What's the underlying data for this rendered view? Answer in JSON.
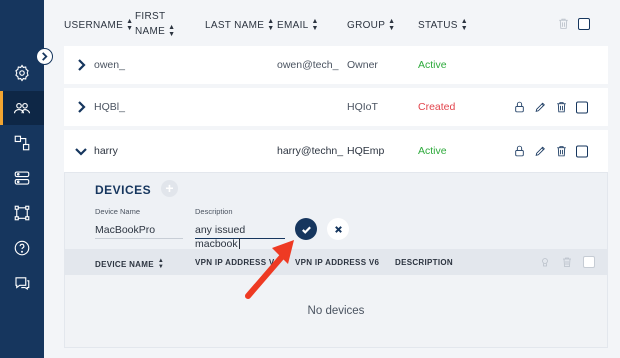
{
  "table": {
    "headers": {
      "username": "USERNAME",
      "first_name_line1": "FIRST",
      "first_name_line2": "NAME",
      "last_name": "LAST NAME",
      "email": "EMAIL",
      "group": "GROUP",
      "status": "STATUS"
    },
    "rows": [
      {
        "username": "owen_",
        "email": "owen@tech_",
        "group": "Owner",
        "status": "Active"
      },
      {
        "username": "HQBl_",
        "email": "",
        "group": "HQIoT",
        "status": "Created"
      },
      {
        "username": "harry",
        "email": "harry@techn_",
        "group": "HQEmp",
        "status": "Active"
      }
    ]
  },
  "devices": {
    "title": "DEVICES",
    "add_symbol": "+",
    "device_name_label": "Device Name",
    "device_name_value": "MacBookPro",
    "description_label": "Description",
    "description_value": "any issued macbook",
    "columns": {
      "device_name": "DEVICE NAME",
      "vpn_v4": "VPN IP ADDRESS V4",
      "vpn_v6": "VPN IP ADDRESS V6",
      "description": "DESCRIPTION"
    },
    "empty_text": "No devices"
  },
  "colors": {
    "sidebar": "#16365e",
    "accent": "#f2a531",
    "active": "#2eaa3c",
    "created": "#e2444c",
    "annotation_arrow": "#ee3a23"
  },
  "icons": {
    "sidebar": [
      "settings-icon",
      "users-icon",
      "flow-icon",
      "servers-icon",
      "network-icon",
      "help-icon",
      "chat-icon"
    ],
    "row_actions": [
      "lock-icon",
      "edit-icon",
      "trash-icon",
      "checkbox"
    ]
  }
}
